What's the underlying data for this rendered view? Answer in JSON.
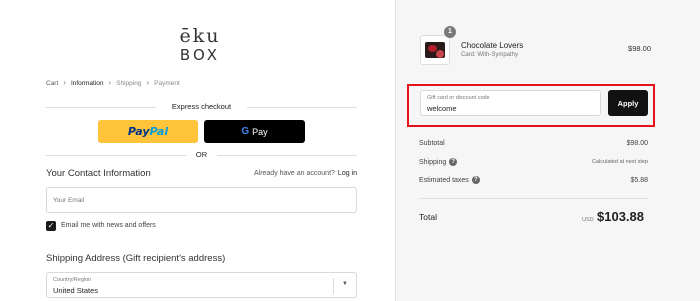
{
  "logo": {
    "line1": "ēku",
    "line2": "BOX"
  },
  "breadcrumb": [
    "Cart",
    "Information",
    "Shipping",
    "Payment"
  ],
  "express_checkout": {
    "title": "Express checkout",
    "paypal": {
      "pay": "Pay",
      "pal": "Pal"
    },
    "gpay": {
      "g": "G",
      "label": "Pay"
    },
    "or": "OR"
  },
  "contact": {
    "title": "Your Contact Information",
    "account_prompt": "Already have an account?",
    "login_link": "Log in",
    "email_placeholder": "Your Email",
    "newsletter_label": "Email me with news and offers",
    "newsletter_checked": true
  },
  "shipping": {
    "title": "Shipping Address (Gift recipient's address)",
    "country_label": "Country/Region",
    "country_value": "United States"
  },
  "order": {
    "item": {
      "quantity": "1",
      "name": "Chocolate Lovers",
      "variant": "Card: With-Sympathy",
      "price": "$98.00"
    },
    "discount": {
      "label": "Gift card or discount code",
      "value": "welcome",
      "apply": "Apply"
    },
    "summary": {
      "subtotal_label": "Subtotal",
      "subtotal_value": "$98.00",
      "shipping_label": "Shipping",
      "shipping_value": "Calculated at next step",
      "taxes_label": "Estimated taxes",
      "taxes_value": "$5.88",
      "total_label": "Total",
      "total_currency": "USD",
      "total_value": "$103.88"
    }
  },
  "colors": {
    "paypal_yellow": "#ffc439",
    "highlight_red": "#e5121c",
    "panel_bg": "#f6f6f6"
  }
}
